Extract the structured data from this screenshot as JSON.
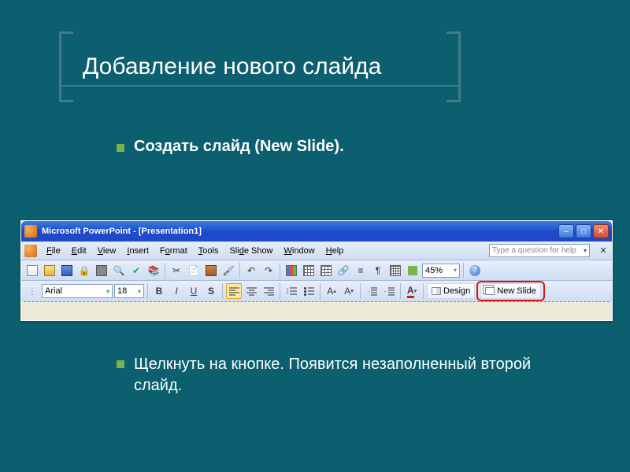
{
  "slide": {
    "title": "Добавление нового слайда",
    "bullet1": "Создать слайд (New Slide).",
    "bullet2": "Щелкнуть на кнопке. Появится незаполненный второй слайд."
  },
  "window": {
    "caption": "Microsoft PowerPoint - [Presentation1]",
    "menu": {
      "file": "File",
      "edit": "Edit",
      "view": "View",
      "insert": "Insert",
      "format": "Format",
      "tools": "Tools",
      "slideshow": "Slide Show",
      "window": "Window",
      "help": "Help"
    },
    "help_placeholder": "Type a question for help",
    "zoom_value": "45%",
    "font_name": "Arial",
    "font_size": "18",
    "design_label": "Design",
    "new_slide_label": "New Slide"
  }
}
